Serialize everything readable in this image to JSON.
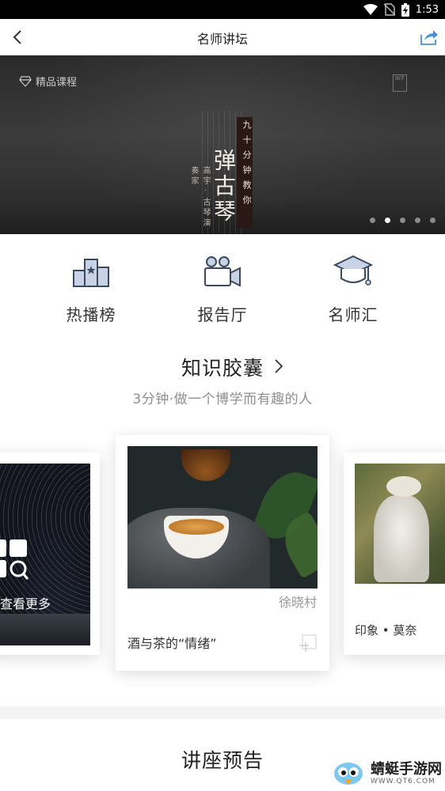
{
  "status_bar": {
    "time": "1:53"
  },
  "navbar": {
    "title": "名师讲坛"
  },
  "banner": {
    "badge_label": "精品课程",
    "tag_text": "九十分钟教你",
    "main_title": "弹古琴",
    "presenter": "高宇·古琴演奏家",
    "seal_text": "国学",
    "slide_count": 5,
    "active_slide": 2
  },
  "entries": [
    {
      "label": "热播榜",
      "icon": "leaderboard-icon"
    },
    {
      "label": "报告厅",
      "icon": "video-camera-icon"
    },
    {
      "label": "名师汇",
      "icon": "graduation-cap-icon"
    }
  ],
  "knowledge": {
    "title": "知识胶囊",
    "subtitle": "3分钟·做一个博学而有趣的人",
    "cards": [
      {
        "caption": "查看更多"
      },
      {
        "author": "徐晓村",
        "name": "酒与茶的“情绪”"
      },
      {
        "name": "印象 • 莫奈"
      }
    ]
  },
  "lectures": {
    "title": "讲座预告"
  },
  "watermark": {
    "name": "蜻蜓手游网",
    "url": "WWW.QT6.COM"
  },
  "colors": {
    "accent_blue": "#4a90d9",
    "icon_fill": "#c8d3e6",
    "icon_stroke": "#3b4a60"
  }
}
